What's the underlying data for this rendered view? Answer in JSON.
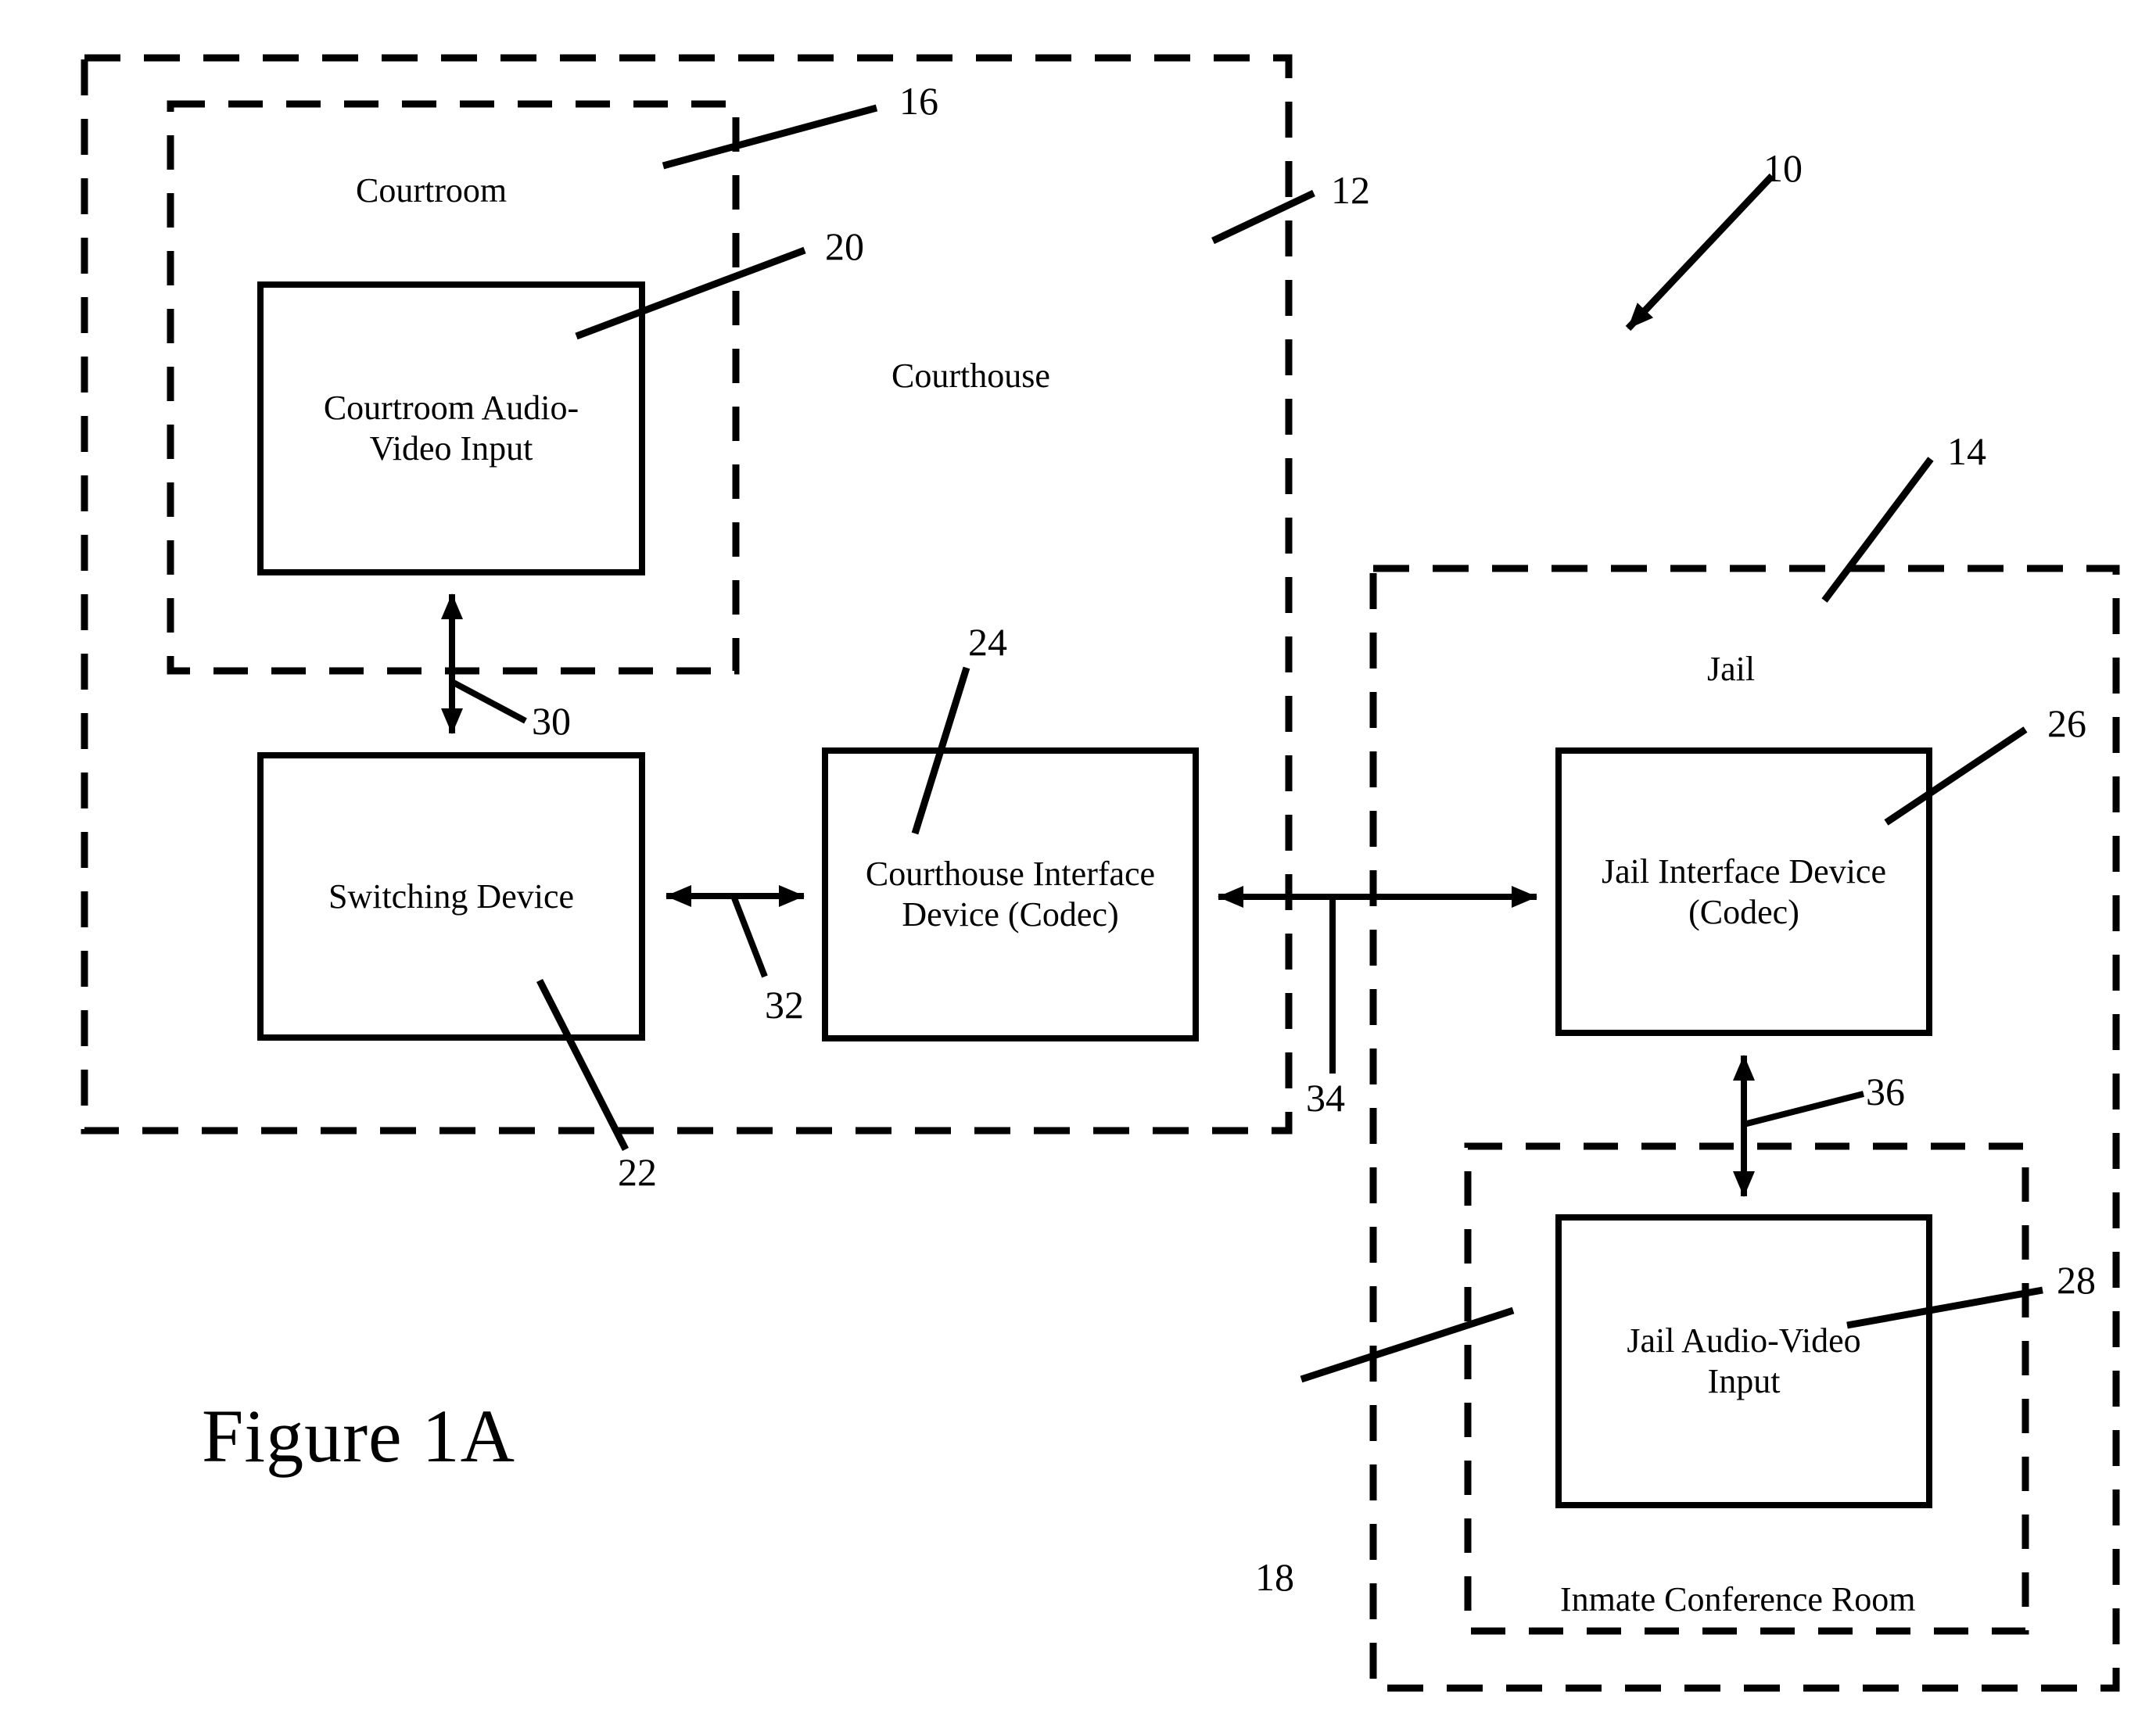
{
  "figure": {
    "title": "Figure 1A"
  },
  "zones": {
    "courthouse": {
      "label": "Courthouse",
      "ref": "12"
    },
    "courtroom": {
      "label": "Courtroom",
      "ref": "16"
    },
    "jail": {
      "label": "Jail",
      "ref": "14"
    },
    "inmate_conference_room": {
      "label": "Inmate Conference Room",
      "ref": "18"
    },
    "system": {
      "ref": "10"
    }
  },
  "blocks": [
    {
      "id": "courtroom-av-input",
      "label": "Courtroom Audio-Video Input",
      "ref": "20"
    },
    {
      "id": "switching-device",
      "label": "Switching Device",
      "ref": "22"
    },
    {
      "id": "courthouse-interface-device",
      "label": "Courthouse Interface Device (Codec)",
      "ref": "24"
    },
    {
      "id": "jail-interface-device",
      "label": "Jail Interface Device (Codec)",
      "ref": "26"
    },
    {
      "id": "jail-av-input",
      "label": "Jail Audio-Video Input",
      "ref": "28"
    }
  ],
  "connections": [
    {
      "id": "courtroom-av-to-switching",
      "ref": "30"
    },
    {
      "id": "switching-to-courthouse-codec",
      "ref": "32"
    },
    {
      "id": "courthouse-codec-to-jail-codec",
      "ref": "34"
    },
    {
      "id": "jail-codec-to-jail-av",
      "ref": "36"
    }
  ],
  "block_labels": {
    "courtroom_av_line1": "Courtroom Audio-",
    "courtroom_av_line2": "Video Input",
    "switching_device": "Switching Device",
    "courthouse_codec_line1": "Courthouse Interface",
    "courthouse_codec_line2": "Device (Codec)",
    "jail_codec_line1": "Jail Interface Device",
    "jail_codec_line2": "(Codec)",
    "jail_av_line1": "Jail Audio-Video",
    "jail_av_line2": "Input"
  },
  "refs": {
    "r10": "10",
    "r12": "12",
    "r14": "14",
    "r16": "16",
    "r18": "18",
    "r20": "20",
    "r22": "22",
    "r24": "24",
    "r26": "26",
    "r28": "28",
    "r30": "30",
    "r32": "32",
    "r34": "34",
    "r36": "36"
  },
  "colors": {
    "ink": "#000000",
    "paper": "#ffffff"
  }
}
